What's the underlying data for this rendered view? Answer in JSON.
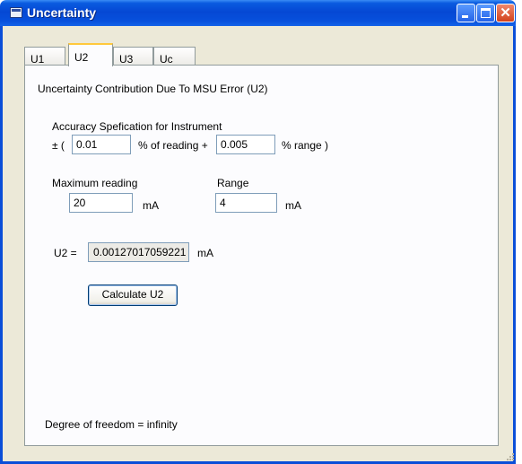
{
  "window": {
    "title": "Uncertainty"
  },
  "tabs": [
    {
      "label": "U1"
    },
    {
      "label": "U2"
    },
    {
      "label": "U3"
    },
    {
      "label": "Uc"
    }
  ],
  "panel": {
    "heading": "Uncertainty Contribution Due To MSU Error (U2)",
    "accuracy_label": "Accuracy Spefication for Instrument",
    "accuracy_prefix": "± (",
    "reading_percent": "0.01",
    "reading_suffix": "% of reading +",
    "range_percent": "0.005",
    "range_suffix": "% range )",
    "max_reading_label": "Maximum reading",
    "max_reading_value": "20",
    "max_reading_unit": "mA",
    "range_label": "Range",
    "range_value": "4",
    "range_unit": "mA",
    "u2_label": "U2 =",
    "u2_value": "0.00127017059221",
    "u2_unit": "mA",
    "calculate_label": "Calculate U2",
    "dof_text": "Degree of freedom = infinity"
  }
}
